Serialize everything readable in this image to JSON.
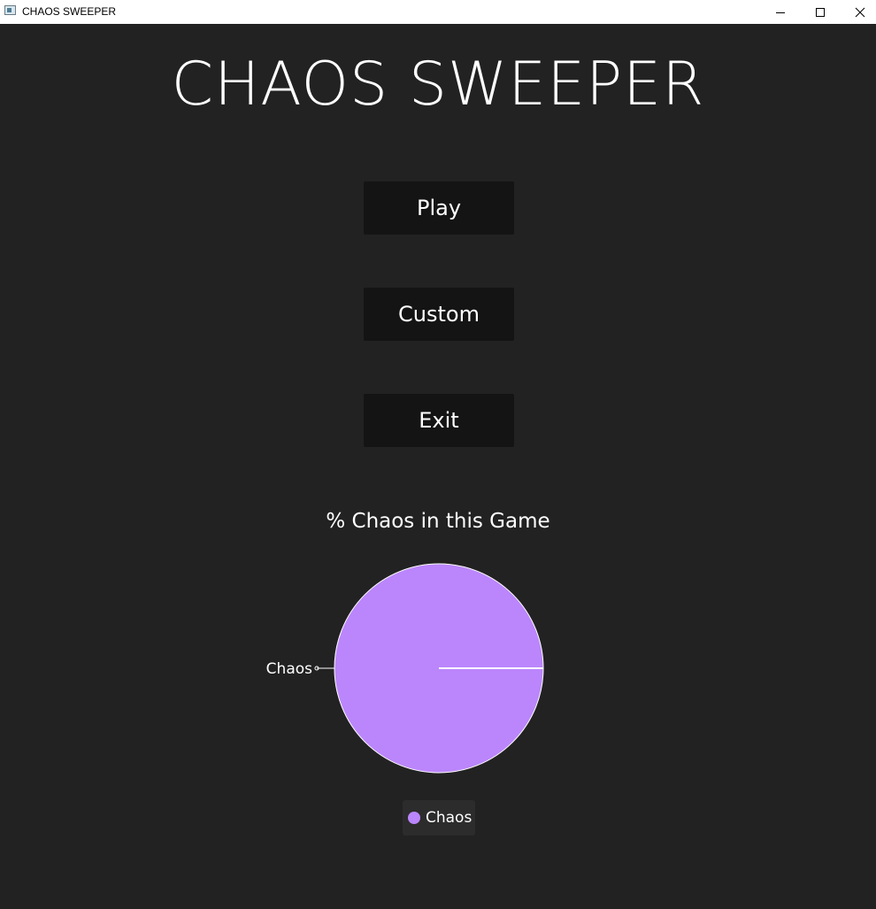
{
  "window": {
    "title": "CHAOS SWEEPER",
    "controls": [
      "minimize-icon",
      "maximize-icon",
      "close-icon"
    ]
  },
  "main": {
    "title": "CHAOS SWEEPER",
    "buttons": {
      "play": "Play",
      "custom": "Custom",
      "exit": "Exit"
    }
  },
  "colors": {
    "background": "#222222",
    "button": "#141414",
    "slice": "#bb86fc",
    "text": "#ffffff"
  },
  "chart_data": {
    "type": "pie",
    "title": "% Chaos in this Game",
    "categories": [
      "Chaos"
    ],
    "values": [
      100
    ],
    "legend": "bottom"
  }
}
